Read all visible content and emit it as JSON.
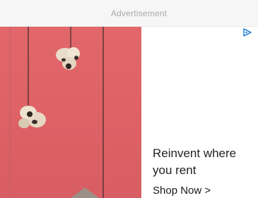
{
  "ad": {
    "label": "Advertisement",
    "headline": "Reinvent where you rent",
    "cta_label": "Shop Now >",
    "icons": {
      "adchoices": "adchoices-icon"
    },
    "colors": {
      "image_background": "#e0656a",
      "adchoices": "#2f86d6",
      "text": "#222222"
    }
  }
}
